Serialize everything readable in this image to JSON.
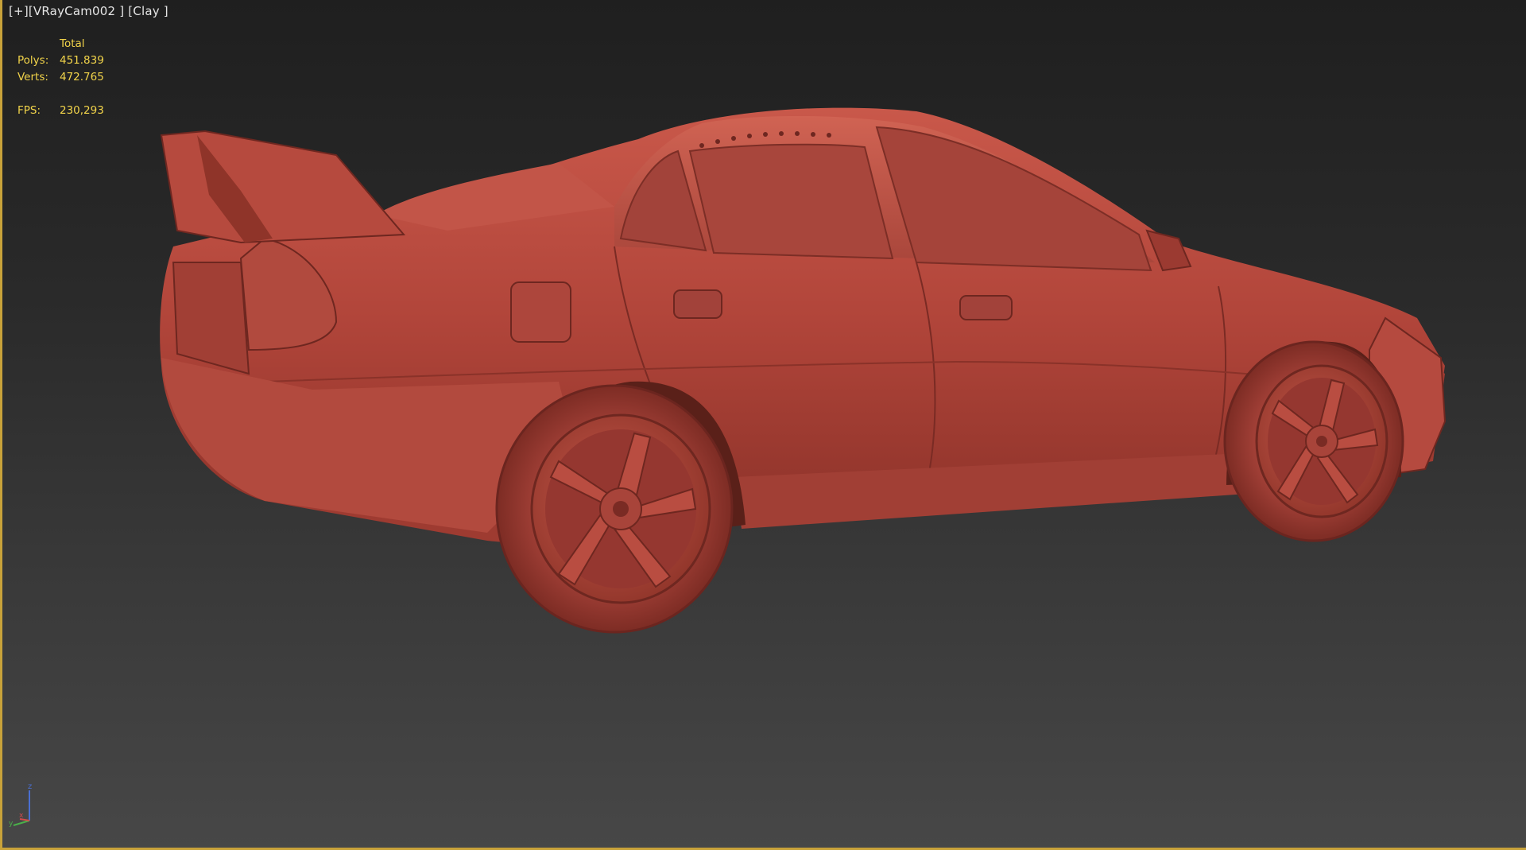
{
  "viewport": {
    "menu": "[+]",
    "camera": "[VRayCam002 ]",
    "shading": "[Clay ]",
    "accent_color": "#c8a23a"
  },
  "stats": {
    "header": "Total",
    "rows": [
      {
        "label": "Polys:",
        "value": "451.839"
      },
      {
        "label": "Verts:",
        "value": "472.765"
      }
    ],
    "fps_label": "FPS:",
    "fps_value": "230,293",
    "text_color": "#f2d44a"
  },
  "model": {
    "clay_color": "#b5473c"
  },
  "gizmo": {
    "axis_z": "z",
    "axis_x": "x",
    "axis_y": "y"
  }
}
